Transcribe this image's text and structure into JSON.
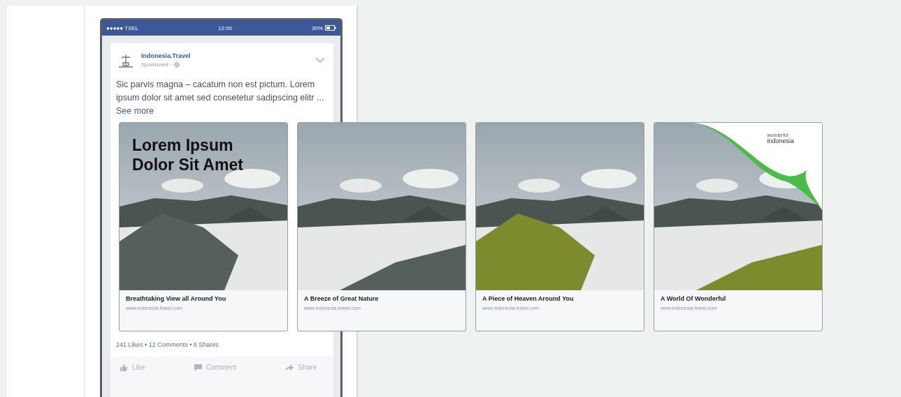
{
  "status_bar": {
    "carrier": "●●●●● TSEL",
    "time": "12:00",
    "battery": "30%"
  },
  "post": {
    "page_name": "Indonesia.Travel",
    "sponsored": "Sponsored ·",
    "text": "Sic parvis magna – cacatum non est pictum. Lorem ipsum dolor sit amet sed consetetur sadipscing elitr ...",
    "see_more": "See more",
    "carousel": [
      {
        "headline": "Lorem Ipsum Dolor Sit Amet",
        "title": "Breathtaking View all Around You",
        "url": "www.indonesia.travel.com"
      },
      {
        "title": "A Breeze of Great Nature",
        "url": "www.indonesia.travel.com"
      },
      {
        "title": "A Piece of Heaven Around You",
        "url": "www.indonesia.travel.com"
      },
      {
        "logo": {
          "line1": "wonderful",
          "line2": "indonesia"
        },
        "title": "A World Of Wonderful",
        "url": "www.indonesia.travel.com"
      }
    ],
    "stats": "241 Likes • 12 Comments • 6 Shares",
    "actions": [
      {
        "kind": "like",
        "label": "Like"
      },
      {
        "kind": "comment",
        "label": "Comment"
      },
      {
        "kind": "share",
        "label": "Share"
      }
    ]
  }
}
